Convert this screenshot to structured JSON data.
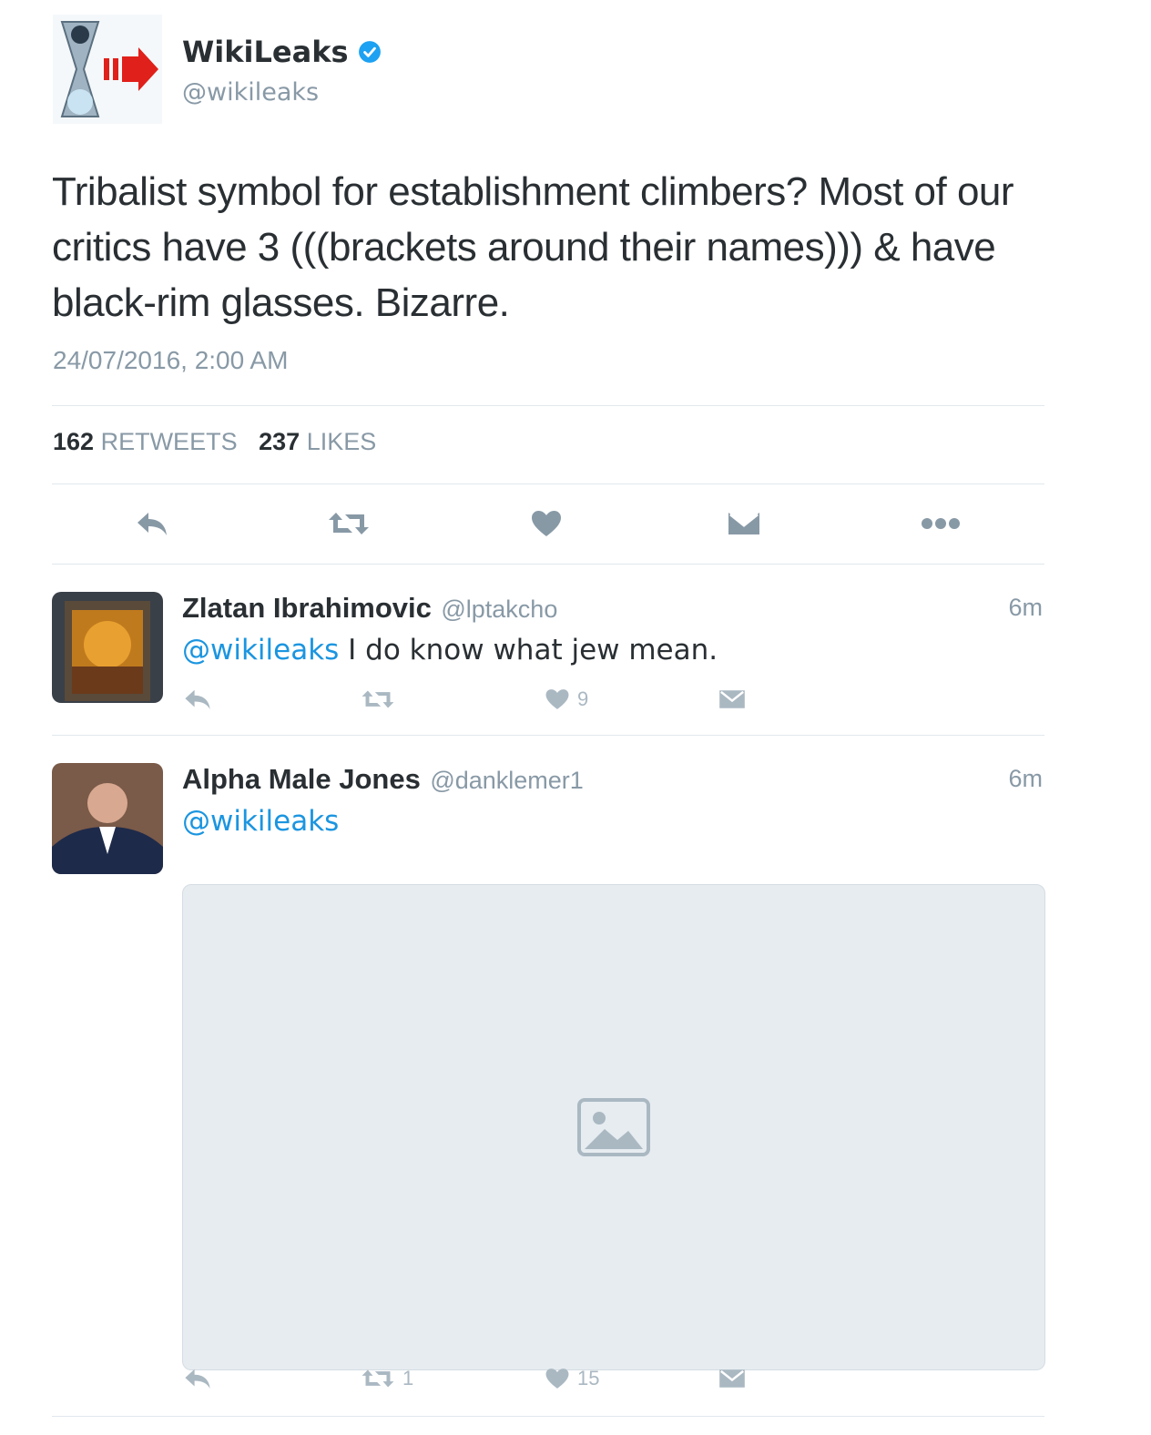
{
  "tweet": {
    "author_name": "WikiLeaks",
    "author_handle": "@wikileaks",
    "text": "Tribalist symbol for establishment climbers? Most of our critics have 3 (((brackets around their names))) & have black-rim glasses. Bizarre.",
    "timestamp": "24/07/2016, 2:00 AM",
    "retweets_count": "162",
    "retweets_label": "RETWEETS",
    "likes_count": "237",
    "likes_label": "LIKES"
  },
  "replies": [
    {
      "name": "Zlatan Ibrahimovic",
      "handle": "@lptakcho",
      "time": "6m",
      "mention": "@wikileaks",
      "text": " I do know what jew mean.",
      "retweets": "",
      "likes": "9"
    },
    {
      "name": "Alpha Male Jones",
      "handle": "@danklemer1",
      "time": "6m",
      "mention": "@wikileaks",
      "text": "",
      "retweets": "1",
      "likes": "15"
    }
  ],
  "colors": {
    "link": "#1b95e0",
    "muted": "#8899a6",
    "icon": "#aab8c2",
    "verified": "#1da1f2",
    "divider": "#e1e8ed"
  },
  "icons": [
    "reply-icon",
    "retweet-icon",
    "like-icon",
    "message-icon",
    "more-icon",
    "verified-badge-icon"
  ]
}
